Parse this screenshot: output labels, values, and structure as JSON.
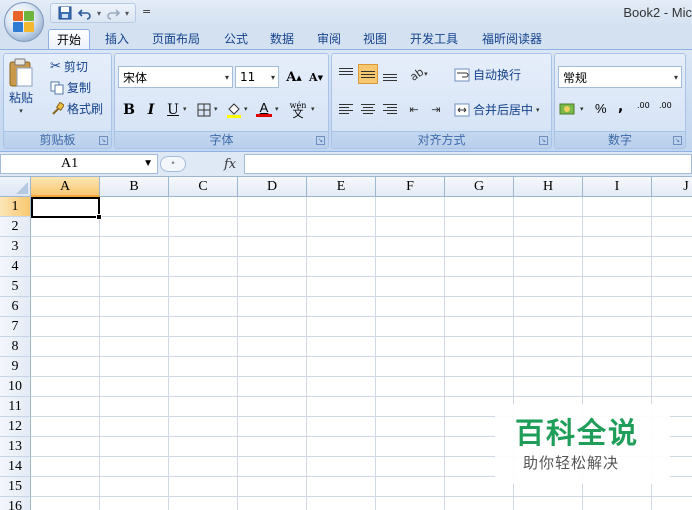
{
  "window": {
    "title": "Book2 - Mic"
  },
  "quick_access": {
    "save_icon": "save-icon",
    "undo_icon": "undo-icon",
    "redo_icon": "redo-icon",
    "customize": "="
  },
  "tabs": [
    {
      "label": "开始"
    },
    {
      "label": "插入"
    },
    {
      "label": "页面布局"
    },
    {
      "label": "公式"
    },
    {
      "label": "数据"
    },
    {
      "label": "审阅"
    },
    {
      "label": "视图"
    },
    {
      "label": "开发工具"
    },
    {
      "label": "福昕阅读器"
    }
  ],
  "ribbon": {
    "clipboard": {
      "paste": "粘贴",
      "cut": "剪切",
      "copy": "复制",
      "format_painter": "格式刷",
      "group_label": "剪贴板"
    },
    "font": {
      "name": "宋体",
      "size": "11",
      "bold": "B",
      "italic": "I",
      "underline": "U",
      "font_color_letter": "A",
      "phonetic": "wén",
      "group_label": "字体"
    },
    "alignment": {
      "wrap_text": "自动换行",
      "merge_center": "合并后居中",
      "group_label": "对齐方式"
    },
    "number": {
      "format": "常规",
      "percent": "%",
      "comma": ",",
      "inc_decimal": ".00",
      "dec_decimal": ".00",
      "group_label": "数字"
    }
  },
  "formula_bar": {
    "name_box": "A1",
    "fx": "fx",
    "value": ""
  },
  "sheet": {
    "columns": [
      "A",
      "B",
      "C",
      "D",
      "E",
      "F",
      "G",
      "H",
      "I",
      "J"
    ],
    "rows": [
      "1",
      "2",
      "3",
      "4",
      "5",
      "6",
      "7",
      "8",
      "9",
      "10",
      "11",
      "12",
      "13",
      "14",
      "15",
      "16"
    ],
    "active_cell": "A1"
  },
  "watermark": {
    "title": "百科全说",
    "subtitle": "助你轻松解决"
  },
  "colors": {
    "ribbon_bg": "#c9dbf1",
    "selected_header": "#f8c870",
    "watermark_green": "#1e9e58"
  }
}
